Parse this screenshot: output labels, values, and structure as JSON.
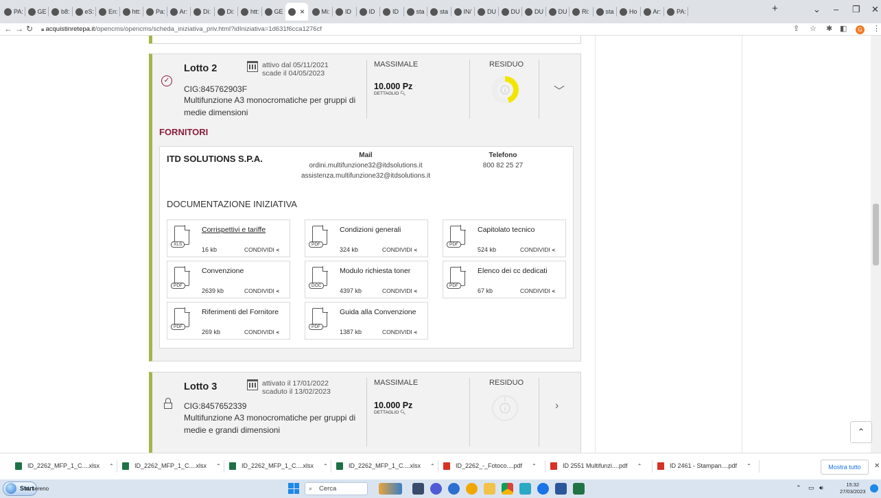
{
  "browser": {
    "tabs": [
      {
        "label": "PA:"
      },
      {
        "label": "GE"
      },
      {
        "label": "b8:"
      },
      {
        "label": "eS:"
      },
      {
        "label": "En:"
      },
      {
        "label": "htt:"
      },
      {
        "label": "Pa:"
      },
      {
        "label": "Ar:"
      },
      {
        "label": "Di:"
      },
      {
        "label": "Di:"
      },
      {
        "label": "htt:"
      },
      {
        "label": "GE"
      },
      {
        "label": ""
      },
      {
        "label": "Mi:"
      },
      {
        "label": "ID"
      },
      {
        "label": "ID"
      },
      {
        "label": "ID"
      },
      {
        "label": "sta"
      },
      {
        "label": "sta"
      },
      {
        "label": "IN/"
      },
      {
        "label": "DU"
      },
      {
        "label": "DU"
      },
      {
        "label": "DU"
      },
      {
        "label": "DU"
      },
      {
        "label": "Ri:"
      },
      {
        "label": "sta"
      },
      {
        "label": "Ho"
      },
      {
        "label": "Ar:"
      },
      {
        "label": "PA:"
      }
    ],
    "active_tab_close": "×",
    "new_tab": "+",
    "window_controls": {
      "collapse": "⌄",
      "minimize": "–",
      "restore": "❐",
      "close": "✕"
    },
    "url_host": "acquistinretepa.it",
    "url_path": "/opencms/opencms/scheda_iniziativa_priv.html?idIniziativa=1d631f6cca1276cf",
    "profile_initial": "G"
  },
  "lotto2": {
    "title": "Lotto 2",
    "date_line1": "attivo dal 05/11/2021",
    "date_line2": "scade il 04/05/2023",
    "cig": "CIG:845762903F",
    "description": "Multifunzione A3 monocromatiche per gruppi di medie dimensioni",
    "massimale_label": "MASSIMALE",
    "massimale_value": "10.000 Pz",
    "dettaglio": "DETTAGLIO",
    "residuo_label": "RESIDUO",
    "residuo_fraction": 0.45,
    "residuo_color": "#f2e600"
  },
  "fornitori_heading": "FORNITORI",
  "supplier": {
    "name": "ITD SOLUTIONS S.P.A.",
    "mail_label": "Mail",
    "mail_1": "ordini.multifunzione32@itdsolutions.it",
    "mail_2": "assistenza.multifunzione32@itdsolutions.it",
    "phone_label": "Telefono",
    "phone": "800 82 25 27"
  },
  "documentazione_heading": "DOCUMENTAZIONE INIZIATIVA",
  "share_label": "CONDIVIDI",
  "documents": [
    {
      "name": "Corrispettivi e tariffe",
      "type": "XLS",
      "size": "16 kb"
    },
    {
      "name": "Condizioni generali",
      "type": "PDF",
      "size": "324 kb"
    },
    {
      "name": "Capitolato tecnico",
      "type": "PDF",
      "size": "524 kb"
    },
    {
      "name": "Convenzione",
      "type": "PDF",
      "size": "2639 kb"
    },
    {
      "name": "Modulo richiesta toner",
      "type": "DOC",
      "size": "4397 kb"
    },
    {
      "name": "Elenco dei cc dedicati",
      "type": "PDF",
      "size": "67 kb"
    },
    {
      "name": "Riferimenti del Fornitore",
      "type": "PDF",
      "size": "269 kb"
    },
    {
      "name": "Guida alla Convenzione",
      "type": "PDF",
      "size": "1387 kb"
    }
  ],
  "lotto3": {
    "title": "Lotto 3",
    "date_line1": "attivato il 17/01/2022",
    "date_line2": "scaduto il 13/02/2023",
    "cig": "CIG:8457652339",
    "description": "Multifunzione A3 monocromatiche per gruppi di medie e grandi dimensioni",
    "massimale_label": "MASSIMALE",
    "massimale_value": "10.000 Pz",
    "dettaglio": "DETTAGLIO",
    "residuo_label": "RESIDUO"
  },
  "downloads": [
    {
      "name": "ID_2262_MFP_1_C....xlsx",
      "kind": "xlsx"
    },
    {
      "name": "ID_2262_MFP_1_C....xlsx",
      "kind": "xlsx"
    },
    {
      "name": "ID_2262_MFP_1_C....xlsx",
      "kind": "xlsx"
    },
    {
      "name": "ID_2262_MFP_1_C....xlsx",
      "kind": "xlsx"
    },
    {
      "name": "ID_2262_-_Fotoco....pdf",
      "kind": "pdf"
    },
    {
      "name": "ID 2551 Multifunzi....pdf",
      "kind": "pdf"
    },
    {
      "name": "ID 2461 - Stampan....pdf",
      "kind": "pdf"
    }
  ],
  "downloads_show_all": "Mostra tutto",
  "downloads_close": "✕",
  "taskbar": {
    "start_label": "Start",
    "weather": "al. sereno",
    "search_placeholder": "Cerca",
    "time": "15:32",
    "date": "27/03/2023"
  },
  "colors": {
    "accent_green": "#a3b64a",
    "fornitori": "#8a1c3e",
    "residuo_yellow": "#f2e600"
  }
}
